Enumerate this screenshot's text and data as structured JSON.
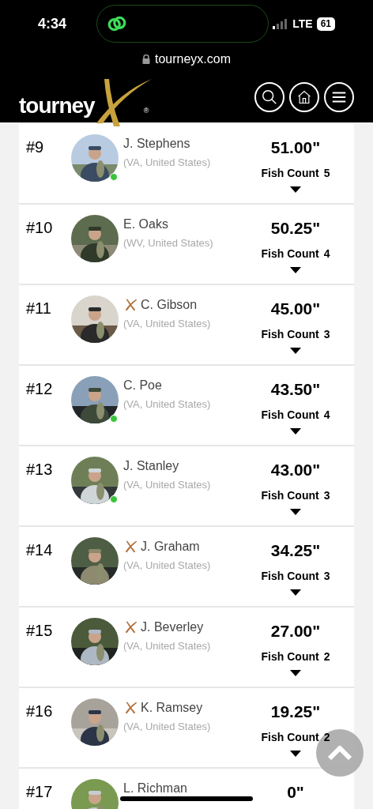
{
  "status_bar": {
    "time": "4:34",
    "network": "LTE",
    "battery": "61"
  },
  "address_bar": {
    "url": "tourneyx.com"
  },
  "header": {
    "logo_text": "tourney",
    "logo_mark": "®"
  },
  "leaderboard": [
    {
      "rank": "#9",
      "name": "J. Stephens",
      "location": "(VA, United States)",
      "score": "51.00\"",
      "fish_count_label": "Fish Count",
      "fish_count": "5",
      "online": true,
      "pro": false
    },
    {
      "rank": "#10",
      "name": "E. Oaks",
      "location": "(WV, United States)",
      "score": "50.25\"",
      "fish_count_label": "Fish Count",
      "fish_count": "4",
      "online": false,
      "pro": false
    },
    {
      "rank": "#11",
      "name": "C. Gibson",
      "location": "(VA, United States)",
      "score": "45.00\"",
      "fish_count_label": "Fish Count",
      "fish_count": "3",
      "online": false,
      "pro": true
    },
    {
      "rank": "#12",
      "name": "C. Poe",
      "location": "(VA, United States)",
      "score": "43.50\"",
      "fish_count_label": "Fish Count",
      "fish_count": "4",
      "online": true,
      "pro": false
    },
    {
      "rank": "#13",
      "name": "J. Stanley",
      "location": "(VA, United States)",
      "score": "43.00\"",
      "fish_count_label": "Fish Count",
      "fish_count": "3",
      "online": true,
      "pro": false
    },
    {
      "rank": "#14",
      "name": "J. Graham",
      "location": "(VA, United States)",
      "score": "34.25\"",
      "fish_count_label": "Fish Count",
      "fish_count": "3",
      "online": false,
      "pro": true
    },
    {
      "rank": "#15",
      "name": "J. Beverley",
      "location": "(VA, United States)",
      "score": "27.00\"",
      "fish_count_label": "Fish Count",
      "fish_count": "2",
      "online": false,
      "pro": true
    },
    {
      "rank": "#16",
      "name": "K. Ramsey",
      "location": "(VA, United States)",
      "score": "19.25\"",
      "fish_count_label": "Fish Count",
      "fish_count": "2",
      "online": false,
      "pro": true
    },
    {
      "rank": "#17",
      "name": "L. Richman",
      "score": "0\""
    }
  ]
}
